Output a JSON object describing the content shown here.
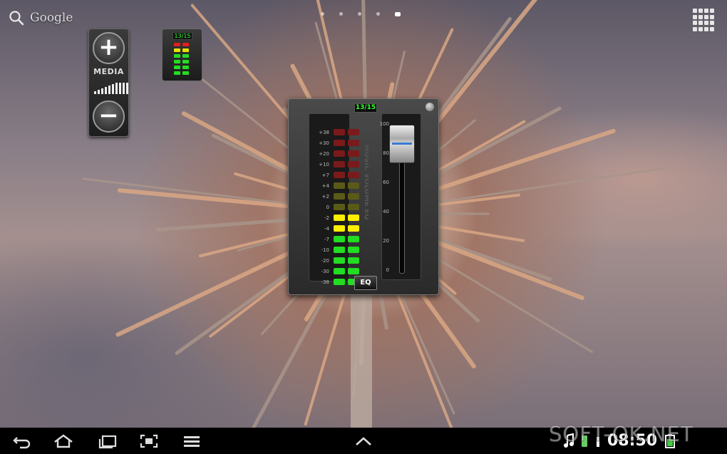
{
  "search": {
    "label": "Google",
    "icon": "search-icon"
  },
  "page_indicator": {
    "count": 5,
    "active": 5
  },
  "media_widget": {
    "plus": "+",
    "label": "MEDIA",
    "minus": "−"
  },
  "mini_widget": {
    "count": "13/15"
  },
  "volume_widget": {
    "count": "13/15",
    "vertical_label": "MUSIC VOLUME EQ",
    "db_labels": [
      "+38",
      "+30",
      "+20",
      "+10",
      "+7",
      "+4",
      "+2",
      "0",
      "-2",
      "-4",
      "-7",
      "-10",
      "-20",
      "-30",
      "-38"
    ],
    "level_fraction": 0.87,
    "scale_labels": [
      "100",
      "80",
      "60",
      "40",
      "20",
      "0"
    ],
    "eq_label": "EQ"
  },
  "status_bar": {
    "time": "08:50"
  },
  "watermark": {
    "text": "SOFT-OK.NET"
  },
  "colors": {
    "led_red": "#7a1a1a",
    "led_red_on": "#e02020",
    "led_olive": "#5a5a18",
    "led_yellow": "#ffee00",
    "led_green": "#22dd22",
    "knob_accent": "#3a7bd5"
  }
}
